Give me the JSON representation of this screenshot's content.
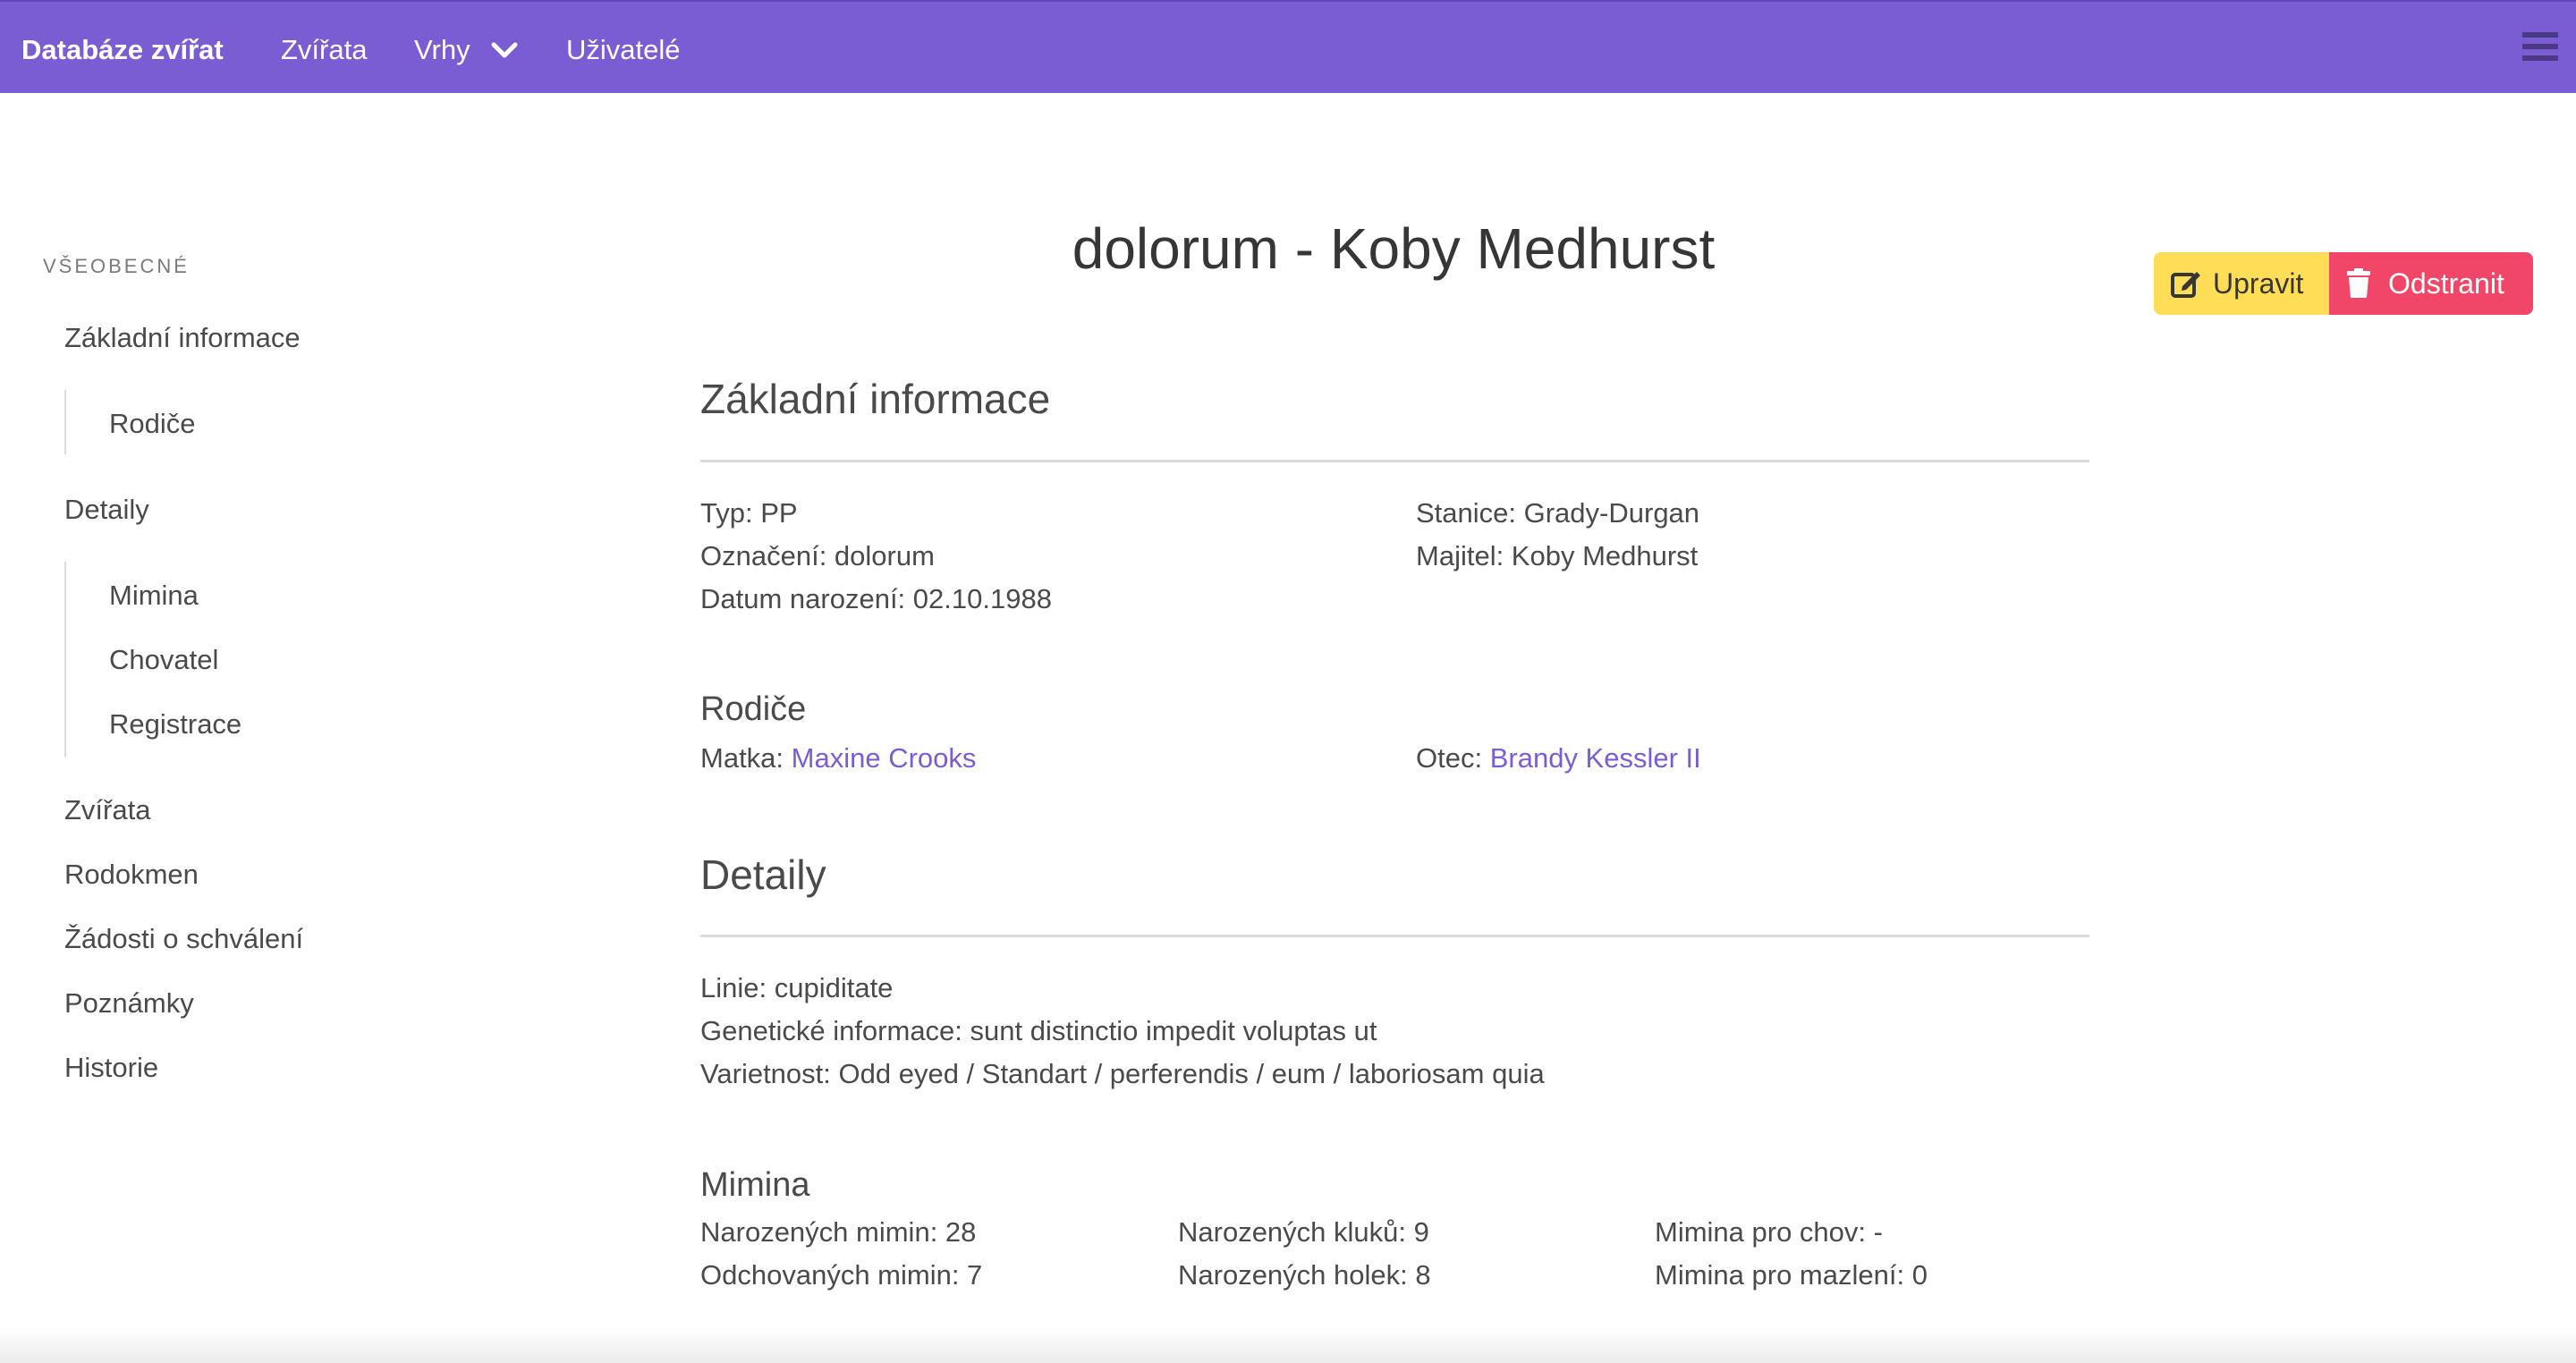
{
  "navbar": {
    "brand": "Databáze zvířat",
    "links": [
      "Zvířata",
      "Vrhy",
      "Uživatelé"
    ]
  },
  "sidebar": {
    "section_label": "Všeobecné",
    "items": [
      "Základní informace",
      "Rodiče",
      "Detaily",
      "Mimina",
      "Chovatel",
      "Registrace",
      "Zvířata",
      "Rodokmen",
      "Žádosti o schválení",
      "Poznámky",
      "Historie"
    ]
  },
  "page": {
    "title": "dolorum - Koby Medhurst",
    "edit_label": "Upravit",
    "delete_label": "Odstranit"
  },
  "basic": {
    "heading": "Základní informace",
    "typ": "Typ: PP",
    "oznaceni": "Označení: dolorum",
    "datum": "Datum narození: 02.10.1988",
    "stanice": "Stanice: Grady-Durgan",
    "majitel": "Majitel: Koby Medhurst"
  },
  "parents": {
    "heading": "Rodiče",
    "mother_label": "Matka:",
    "mother": "Maxine Crooks",
    "father_label": "Otec:",
    "father": "Brandy Kessler II"
  },
  "details": {
    "heading": "Detaily",
    "linie": "Linie: cupiditate",
    "genetika": "Genetické informace: sunt distinctio impedit voluptas ut",
    "varietnost": "Varietnost: Odd eyed / Standart / perferendis / eum / laboriosam quia"
  },
  "babies": {
    "heading": "Mimina",
    "born": "Narozených mimin: 28",
    "raised": "Odchovaných mimin: 7",
    "boys": "Narozených kluků: 9",
    "girls": "Narozených holek: 8",
    "breeding": "Mimina pro chov: -",
    "pets": "Mimina pro mazlení: 0"
  },
  "colors": {
    "primary": "#7b5dd3",
    "warning": "#ffdd57",
    "danger": "#f14668"
  }
}
